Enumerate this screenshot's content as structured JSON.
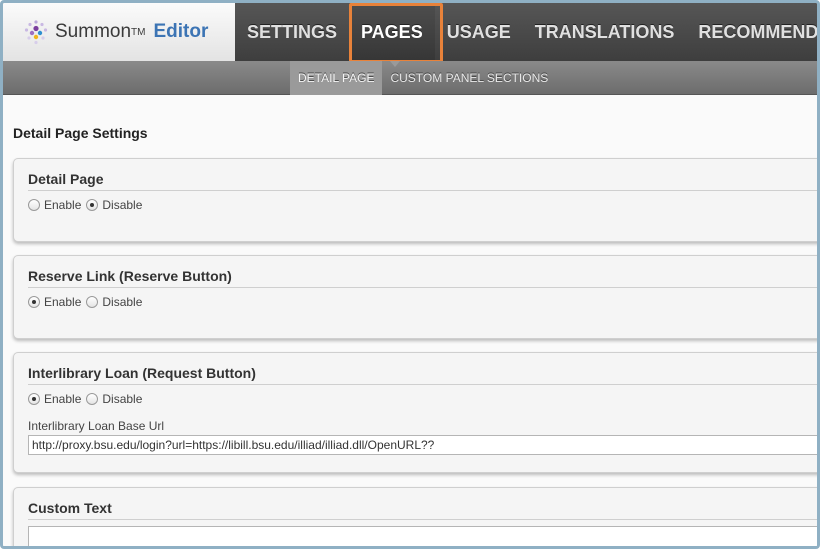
{
  "app": {
    "logo_name": "Summon",
    "logo_tm": "TM",
    "logo_editor": "Editor"
  },
  "nav": {
    "items": [
      "SETTINGS",
      "PAGES",
      "USAGE",
      "TRANSLATIONS",
      "RECOMMENDE"
    ],
    "active": "PAGES"
  },
  "subnav": {
    "items": [
      "DETAIL PAGE",
      "CUSTOM PANEL SECTIONS"
    ],
    "active": "DETAIL PAGE"
  },
  "page": {
    "title": "Detail Page Settings"
  },
  "panels": {
    "detail_page": {
      "title": "Detail Page",
      "enable_label": "Enable",
      "disable_label": "Disable",
      "selected": "Disable"
    },
    "reserve_link": {
      "title": "Reserve Link (Reserve Button)",
      "enable_label": "Enable",
      "disable_label": "Disable",
      "selected": "Enable"
    },
    "interlibrary_loan": {
      "title": "Interlibrary Loan (Request Button)",
      "enable_label": "Enable",
      "disable_label": "Disable",
      "selected": "Enable",
      "base_url_label": "Interlibrary Loan Base Url",
      "base_url_value": "http://proxy.bsu.edu/login?url=https://libill.bsu.edu/illiad/illiad.dll/OpenURL??"
    },
    "custom_text": {
      "title": "Custom Text"
    }
  },
  "colors": {
    "accent_highlight": "#e8823a",
    "editor_blue": "#3c74b4",
    "nav_bg": "#4a4a4a",
    "frame_border": "#8fb0c4"
  },
  "icons": {
    "logo": "summon-dots-logo-icon"
  }
}
